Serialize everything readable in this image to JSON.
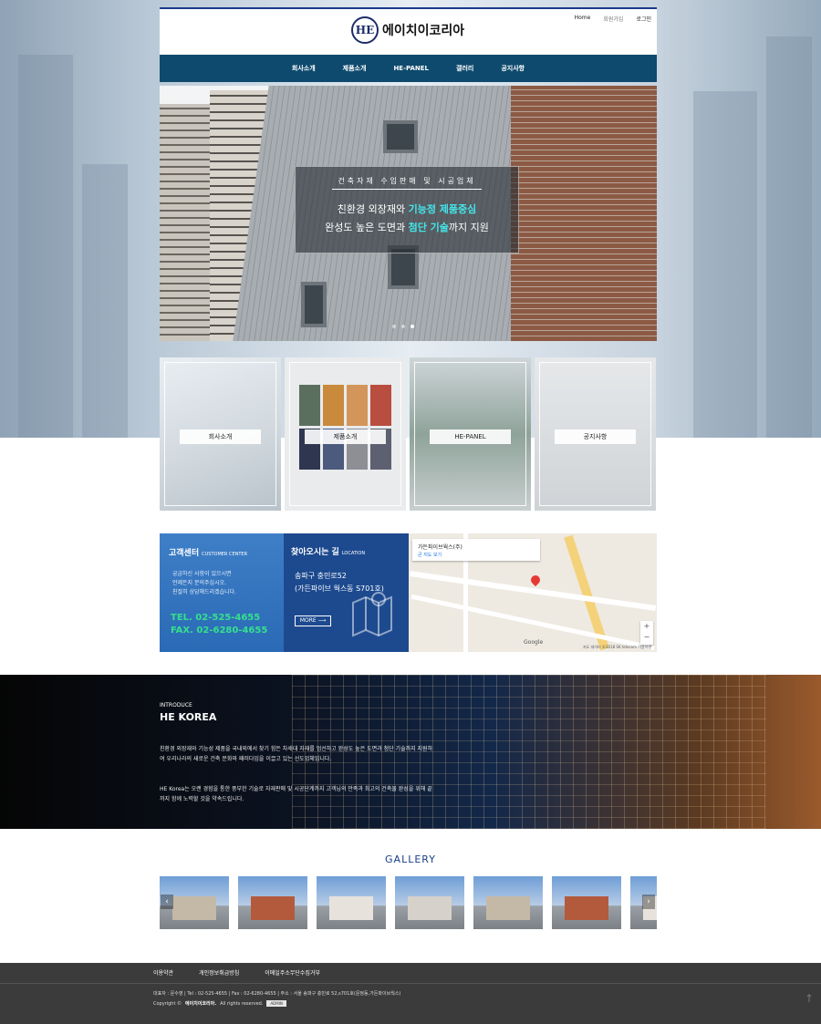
{
  "header": {
    "logo_mark": "HE",
    "brand": "에이치이코리아",
    "util_links": [
      "Home",
      "회원가입",
      "로그인"
    ]
  },
  "nav": [
    "회사소개",
    "제품소개",
    "HE-PANEL",
    "갤러리",
    "공지사항"
  ],
  "hero": {
    "kicker": "건축자재 수입판매 및 시공업체",
    "line1_a": "친환경 외장재와 ",
    "line1_b": "기능정 제품중심",
    "line2_a": "완성도 높은 도면과 ",
    "line2_b": "첨단 기술",
    "line2_c": "까지 지원"
  },
  "tiles": [
    "회사소개",
    "제품소개",
    "HE-PANEL",
    "공지사항"
  ],
  "customer_center": {
    "title": "고객센터",
    "subtitle": "CUSTOMER CENTER",
    "lines": [
      "궁금하신 사항이 있으시면",
      "언제든지 문의주십시오.",
      "친절히 상담해드리겠습니다."
    ],
    "tel": "TEL. 02-525-4655",
    "fax": "FAX. 02-6280-4655"
  },
  "location": {
    "title": "찾아오시는 길",
    "subtitle": "LOCATION",
    "addr1": "송파구 충민로52",
    "addr2": "(가든파이브 웍스동 S701호)",
    "more": "MORE ⟶"
  },
  "map": {
    "place": "가든파이브웍스(주)",
    "view": "큰 지도 보기",
    "google": "Google",
    "copyright": "지도 데이터 ©2018 SK telecom  이용약관"
  },
  "intro": {
    "kicker": "INTRODUCE",
    "title": "HE KOREA",
    "p1": "친환경 외장재와 기능성 제품을 국내외에서 찾기 힘든 차세대 자재를 엄선하고 완성도 높은 도면과 첨단 기술까지 지원하여 우리나라의 새로운 건축 문화와 패러다임을 이끌고 있는 선도업체입니다.",
    "p2": "HE Korea는 오랜 경험을 통한 풍부한 기술로 자재판매 및 시공단계까지 고객님의 만족과 최고의 건축물 완성을 위해 끝까지 함께 노력할 것을 약속드립니다."
  },
  "gallery": {
    "title": "GALLERY",
    "prev": "‹",
    "next": "›"
  },
  "footer": {
    "links": [
      "이용약관",
      "개인정보취급방침",
      "이메일주소무단수집거부"
    ],
    "info": "대표자 : 문수영  |  Tel : 02-525-4655  |  Fax : 02-6280-4655  |  주소 : 서울 송파구 충민로 52,s701호(문정동,가든파이브웍스)",
    "copy_prefix": "Copyright ©",
    "copy_brand": "에이치이코리아.",
    "copy_suffix": "All rights reserved.",
    "admin": "ADMIN"
  },
  "colors": {
    "nav_bg": "#0e4a6e",
    "accent_cyan": "#43e6ea",
    "tel_green": "#35e08c",
    "footer_bg": "#3b3b3b"
  },
  "icons": [
    "top-arrow-icon",
    "map-pin-icon",
    "map-fold-icon"
  ]
}
